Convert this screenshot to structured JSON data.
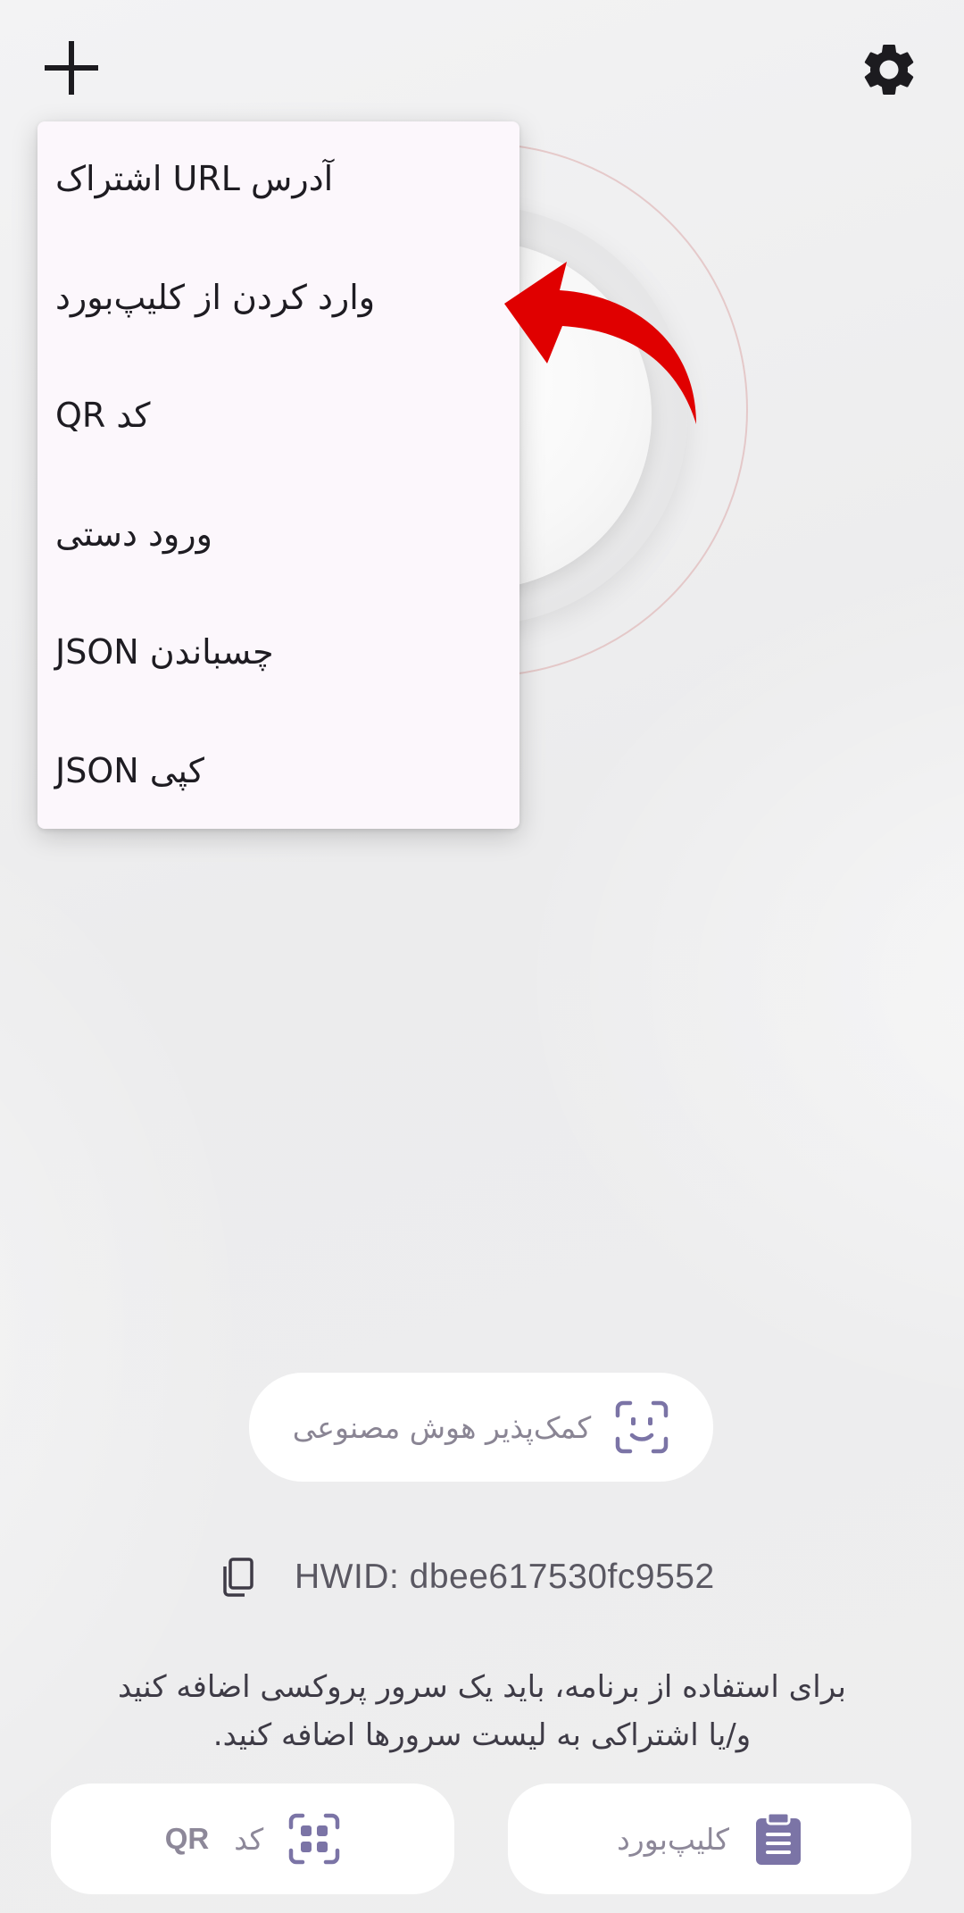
{
  "menu": {
    "items": [
      {
        "label": "آدرس URL اشتراک"
      },
      {
        "label": "وارد کردن از کلیپ‌بورد"
      },
      {
        "label": "کد QR"
      },
      {
        "label": "ورود دستی"
      },
      {
        "label": "چسباندن JSON"
      },
      {
        "label": "کپی JSON"
      }
    ]
  },
  "ai_helper": {
    "label": "کمک‌پذیر هوش مصنوعی"
  },
  "hwid": {
    "text": "HWID: dbee617530fc9552"
  },
  "info": {
    "line1": "برای استفاده از برنامه، باید یک سرور پروکسی اضافه کنید",
    "line2": "و/یا اشتراکی به لیست سرورها اضافه کنید."
  },
  "bottom": {
    "clipboard_label": "کلیپ‌بورد",
    "qr_label_word": "کد",
    "qr_label_code": "QR"
  },
  "colors": {
    "accent": "#7b74a6",
    "arrow": "#e00000",
    "menu_bg": "#fcf7fc"
  },
  "icons": [
    "plus-icon",
    "gear-icon",
    "face-scan-icon",
    "copy-icon",
    "clipboard-icon",
    "qr-scan-icon",
    "arrow-annotation"
  ]
}
